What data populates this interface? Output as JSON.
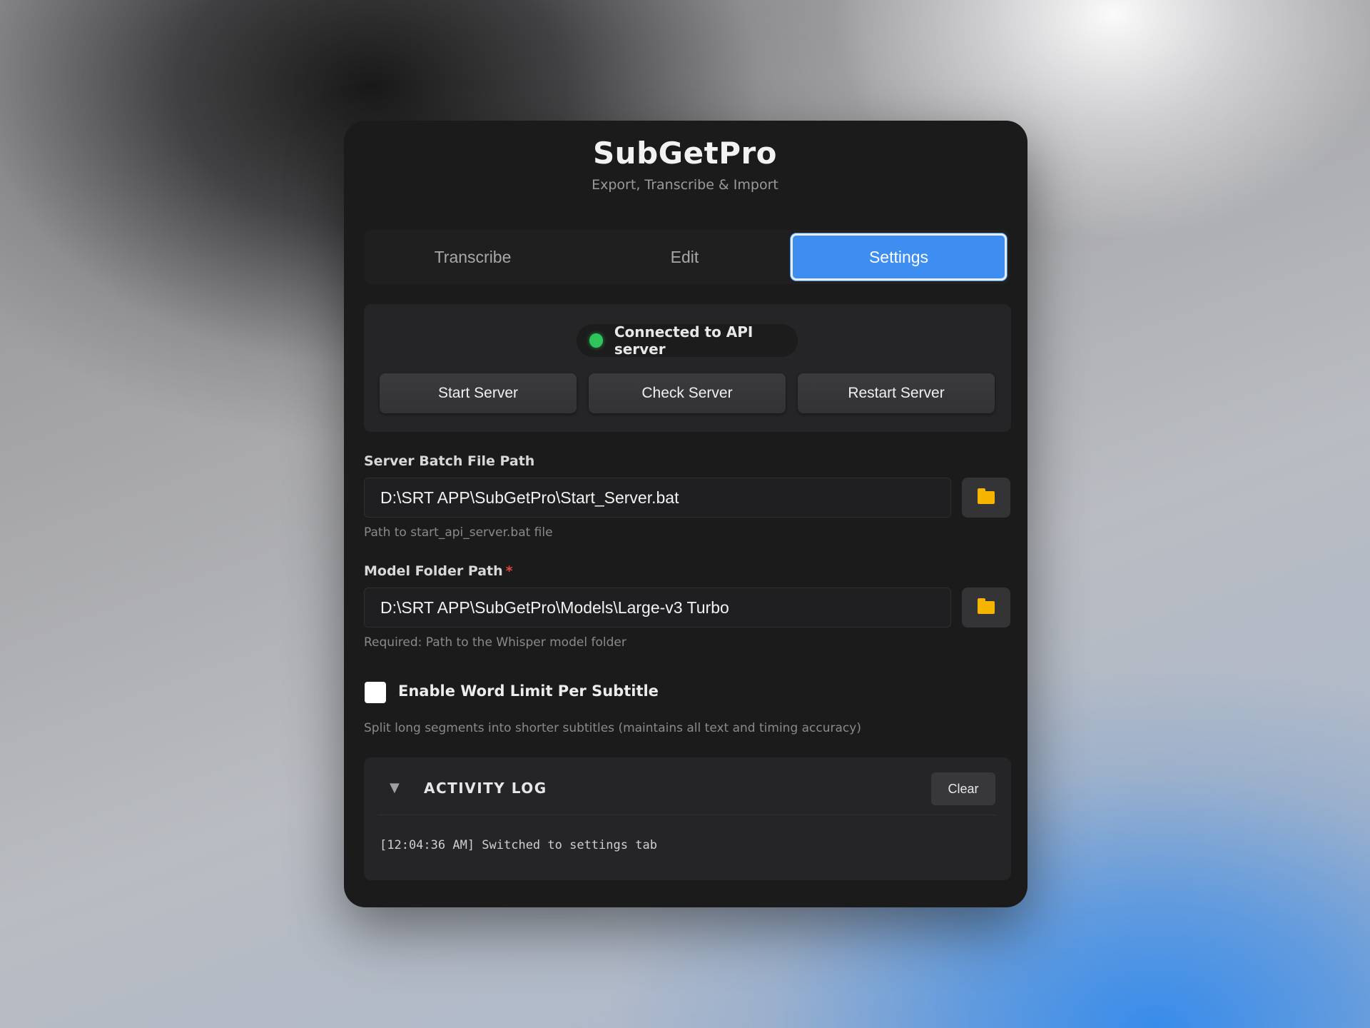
{
  "app": {
    "title": "SubGetPro",
    "subtitle": "Export, Transcribe & Import"
  },
  "tabs": [
    {
      "label": "Transcribe",
      "active": false
    },
    {
      "label": "Edit",
      "active": false
    },
    {
      "label": "Settings",
      "active": true
    }
  ],
  "server": {
    "status_text": "Connected to API server",
    "status_color": "#2ec65a",
    "start_label": "Start Server",
    "check_label": "Check Server",
    "restart_label": "Restart Server"
  },
  "batch_path": {
    "label": "Server Batch File Path",
    "value": "D:\\SRT APP\\SubGetPro\\Start_Server.bat",
    "help": "Path to start_api_server.bat file",
    "browse_icon": "folder-icon"
  },
  "model_path": {
    "label": "Model Folder Path",
    "required_mark": "*",
    "value": "D:\\SRT APP\\SubGetPro\\Models\\Large-v3 Turbo",
    "help": "Required: Path to the Whisper model folder",
    "browse_icon": "folder-icon"
  },
  "word_limit": {
    "label": "Enable Word Limit Per Subtitle",
    "checked": false,
    "help": "Split long segments into shorter subtitles (maintains all text and timing accuracy)"
  },
  "activity_log": {
    "caret": "▼",
    "title": "ACTIVITY LOG",
    "clear_label": "Clear",
    "entries": [
      "[12:04:36 AM] Switched to settings tab"
    ]
  },
  "colors": {
    "accent": "#3d8ef0",
    "panel": "#1b1b1c",
    "folder": "#f4b400"
  }
}
